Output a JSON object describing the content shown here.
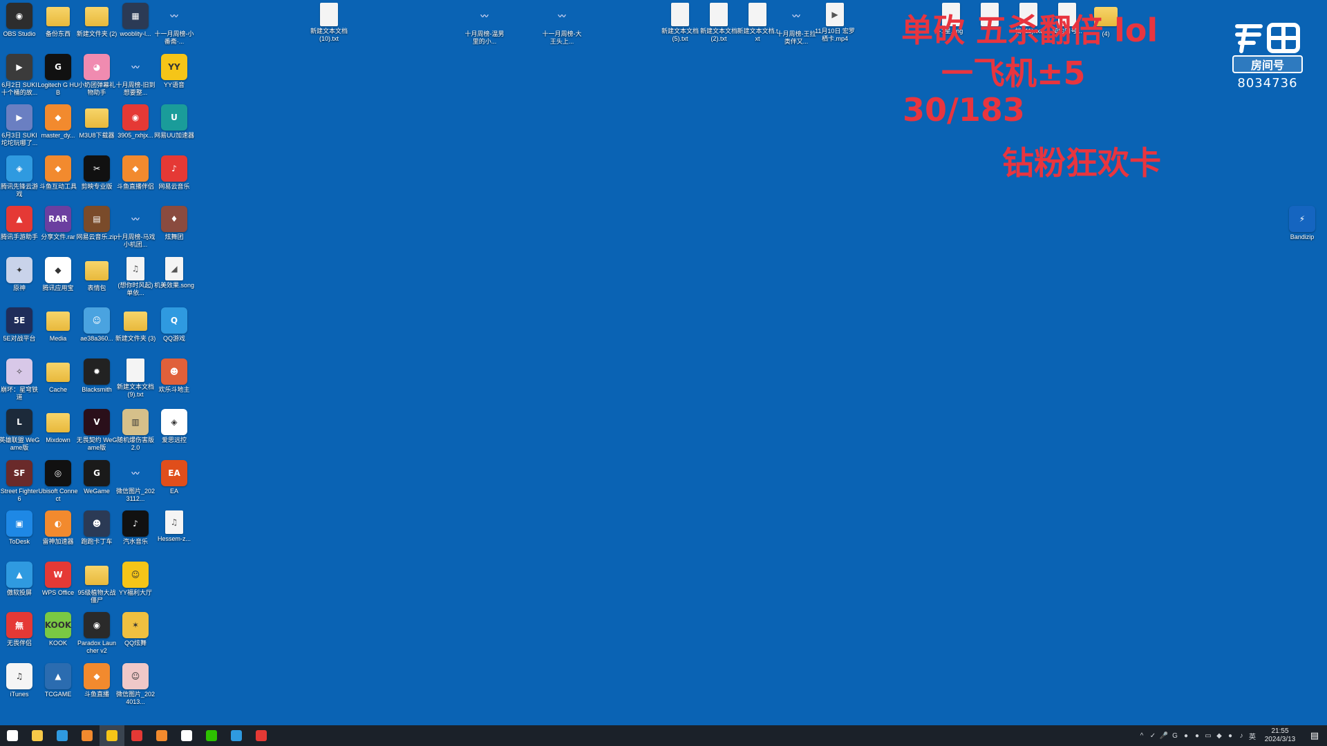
{
  "desktop_icons": [
    {
      "label": "OBS Studio",
      "kind": "app",
      "color": "#2d2d2d",
      "glyph": "◉",
      "icon": "obs-icon"
    },
    {
      "label": "备份东西",
      "kind": "folder",
      "color": "#e8b93c",
      "glyph": "",
      "icon": "folder-icon"
    },
    {
      "label": "新建文件夹 (2)",
      "kind": "folder",
      "color": "#e8b93c",
      "glyph": "",
      "icon": "folder-icon"
    },
    {
      "label": "wooblity-l...",
      "kind": "app",
      "color": "#2b3a55",
      "glyph": "▦",
      "icon": "app-icon"
    },
    {
      "label": "十一月周榜-小番斋·...",
      "kind": "sticker",
      "color": "#0a63b4",
      "glyph": "〰",
      "icon": "image-icon"
    },
    {
      "label": "6月2日 SUKI 十个桶的故...",
      "kind": "app",
      "color": "#3b3b3b",
      "glyph": "▶",
      "icon": "video-icon"
    },
    {
      "label": "Logitech G HUB",
      "kind": "app",
      "color": "#111111",
      "glyph": "G",
      "icon": "logitech-icon"
    },
    {
      "label": "小奶团弹幕礼物助手",
      "kind": "app",
      "color": "#f08bb0",
      "glyph": "◕",
      "icon": "app-icon"
    },
    {
      "label": "十月周榜-旧到想要整...",
      "kind": "sticker",
      "color": "#0a63b4",
      "glyph": "〰",
      "icon": "image-icon"
    },
    {
      "label": "YY语音",
      "kind": "app",
      "color": "#f5c518",
      "glyph": "YY",
      "icon": "yy-icon"
    },
    {
      "label": "6月3日 SUKI 坨坨玩哪了...",
      "kind": "app",
      "color": "#6a7fc2",
      "glyph": "▶",
      "icon": "video-icon"
    },
    {
      "label": "master_dy...",
      "kind": "app",
      "color": "#f28a2e",
      "glyph": "◆",
      "icon": "douyu-icon"
    },
    {
      "label": "M3U8下载器",
      "kind": "folder",
      "color": "#e8b93c",
      "glyph": "",
      "icon": "folder-icon"
    },
    {
      "label": "3905_rxhjx...",
      "kind": "app",
      "color": "#e53935",
      "glyph": "◉",
      "icon": "app-icon"
    },
    {
      "label": "网易UU加速器",
      "kind": "app",
      "color": "#1a9c9a",
      "glyph": "U",
      "icon": "uu-icon"
    },
    {
      "label": "腾讯先锋云游戏",
      "kind": "app",
      "color": "#2f9ae0",
      "glyph": "◈",
      "icon": "app-icon"
    },
    {
      "label": "斗鱼互动工具",
      "kind": "app",
      "color": "#f28a2e",
      "glyph": "◆",
      "icon": "douyu-icon"
    },
    {
      "label": "剪映专业版",
      "kind": "app",
      "color": "#111111",
      "glyph": "✂",
      "icon": "capcut-icon"
    },
    {
      "label": "斗鱼直播伴侣",
      "kind": "app",
      "color": "#f28a2e",
      "glyph": "◆",
      "icon": "douyu-icon"
    },
    {
      "label": "网易云音乐",
      "kind": "app",
      "color": "#e53935",
      "glyph": "♪",
      "icon": "netease-music-icon"
    },
    {
      "label": "腾讯手游助手",
      "kind": "app",
      "color": "#e53935",
      "glyph": "▲",
      "icon": "app-icon"
    },
    {
      "label": "分享文件.rar",
      "kind": "app",
      "color": "#6b3fa0",
      "glyph": "RAR",
      "icon": "rar-icon"
    },
    {
      "label": "网易云音乐.zip",
      "kind": "app",
      "color": "#7a4b2a",
      "glyph": "▤",
      "icon": "zip-icon"
    },
    {
      "label": "十月周榜-马戏小机团...",
      "kind": "sticker",
      "color": "#0a63b4",
      "glyph": "〰",
      "icon": "image-icon"
    },
    {
      "label": "炫舞团",
      "kind": "app",
      "color": "#8a4b3f",
      "glyph": "♦",
      "icon": "app-icon"
    },
    {
      "label": "原神",
      "kind": "app",
      "color": "#c9d3ea",
      "glyph": "✦",
      "icon": "genshin-icon"
    },
    {
      "label": "腾讯应用宝",
      "kind": "app",
      "color": "#ffffff",
      "glyph": "◆",
      "icon": "app-icon"
    },
    {
      "label": "表情包",
      "kind": "folder",
      "color": "#e8b93c",
      "glyph": "",
      "icon": "folder-icon"
    },
    {
      "label": "(想你时风起) 单依...",
      "kind": "doc",
      "color": "#f4f4f4",
      "glyph": "♫",
      "icon": "mp3-icon"
    },
    {
      "label": "机美效果.song",
      "kind": "doc",
      "color": "#f4f4f4",
      "glyph": "◢",
      "icon": "file-icon"
    },
    {
      "label": "5E对战平台",
      "kind": "app",
      "color": "#1f2d5a",
      "glyph": "5E",
      "icon": "app-icon"
    },
    {
      "label": "Media",
      "kind": "folder",
      "color": "#e8b93c",
      "glyph": "",
      "icon": "folder-icon"
    },
    {
      "label": "ae38a360...",
      "kind": "app",
      "color": "#4aa3e0",
      "glyph": "☺",
      "icon": "image-icon"
    },
    {
      "label": "新建文件夹 (3)",
      "kind": "folder",
      "color": "#e8b93c",
      "glyph": "",
      "icon": "folder-icon"
    },
    {
      "label": "QQ游戏",
      "kind": "app",
      "color": "#2f9ae0",
      "glyph": "Q",
      "icon": "qq-game-icon"
    },
    {
      "label": "崩坏：星穹铁道",
      "kind": "app",
      "color": "#d8c8e8",
      "glyph": "✧",
      "icon": "app-icon"
    },
    {
      "label": "Cache",
      "kind": "folder",
      "color": "#e8b93c",
      "glyph": "",
      "icon": "folder-icon"
    },
    {
      "label": "Blacksmith",
      "kind": "app",
      "color": "#222222",
      "glyph": "✹",
      "icon": "app-icon"
    },
    {
      "label": "新建文本文档 (9).txt",
      "kind": "doc",
      "color": "#f4f4f4",
      "glyph": "",
      "icon": "text-file-icon"
    },
    {
      "label": "欢乐斗地主",
      "kind": "app",
      "color": "#e0603a",
      "glyph": "☻",
      "icon": "app-icon"
    },
    {
      "label": "英雄联盟 WeGame版",
      "kind": "app",
      "color": "#1c2a3a",
      "glyph": "L",
      "icon": "lol-icon"
    },
    {
      "label": "Mixdown",
      "kind": "folder",
      "color": "#e8b93c",
      "glyph": "",
      "icon": "folder-icon"
    },
    {
      "label": "无畏契约 WeGame版",
      "kind": "app",
      "color": "#2a0f1a",
      "glyph": "V",
      "icon": "valorant-icon"
    },
    {
      "label": "随机爆伤害版2.0",
      "kind": "app",
      "color": "#d6c08a",
      "glyph": "▥",
      "icon": "zip-icon"
    },
    {
      "label": "爱思远控",
      "kind": "app",
      "color": "#ffffff",
      "glyph": "◈",
      "icon": "app-icon"
    },
    {
      "label": "Street Fighter 6",
      "kind": "app",
      "color": "#6a2a2a",
      "glyph": "SF",
      "icon": "app-icon"
    },
    {
      "label": "Ubisoft Connect",
      "kind": "app",
      "color": "#111111",
      "glyph": "◎",
      "icon": "ubisoft-icon"
    },
    {
      "label": "WeGame",
      "kind": "app",
      "color": "#1a1a1a",
      "glyph": "G",
      "icon": "wegame-icon"
    },
    {
      "label": "微信图片_2023112...",
      "kind": "sticker",
      "color": "#0a63b4",
      "glyph": "〰",
      "icon": "image-icon"
    },
    {
      "label": "EA",
      "kind": "app",
      "color": "#e04e1b",
      "glyph": "EA",
      "icon": "ea-icon"
    },
    {
      "label": "ToDesk",
      "kind": "app",
      "color": "#1e88e5",
      "glyph": "▣",
      "icon": "todesk-icon"
    },
    {
      "label": "雷神加速器",
      "kind": "app",
      "color": "#f28a2e",
      "glyph": "◐",
      "icon": "app-icon"
    },
    {
      "label": "跑跑卡丁车",
      "kind": "app",
      "color": "#2b3a55",
      "glyph": "☻",
      "icon": "app-icon"
    },
    {
      "label": "汽水音乐",
      "kind": "app",
      "color": "#111111",
      "glyph": "♪",
      "icon": "app-icon"
    },
    {
      "label": "Hessem-z...",
      "kind": "doc",
      "color": "#f4f4f4",
      "glyph": "♫",
      "icon": "wav-icon"
    },
    {
      "label": "傲软投屏",
      "kind": "app",
      "color": "#2f9ae0",
      "glyph": "▲",
      "icon": "app-icon"
    },
    {
      "label": "WPS Office",
      "kind": "app",
      "color": "#e53935",
      "glyph": "W",
      "icon": "wps-icon"
    },
    {
      "label": "95级植物大战僵尸",
      "kind": "folder",
      "color": "#e8b93c",
      "glyph": "",
      "icon": "folder-icon"
    },
    {
      "label": "YY福利大厅",
      "kind": "app",
      "color": "#f5c518",
      "glyph": "☺",
      "icon": "app-icon"
    },
    {
      "label": "无畏伴侣",
      "kind": "app",
      "color": "#e53935",
      "glyph": "無",
      "icon": "app-icon"
    },
    {
      "label": "KOOK",
      "kind": "app",
      "color": "#7ac943",
      "glyph": "KOOK",
      "icon": "kook-icon"
    },
    {
      "label": "Paradox Launcher v2",
      "kind": "app",
      "color": "#2a2a2a",
      "glyph": "◉",
      "icon": "app-icon"
    },
    {
      "label": "QQ炫舞",
      "kind": "app",
      "color": "#f0c040",
      "glyph": "✶",
      "icon": "app-icon"
    },
    {
      "label": "iTunes",
      "kind": "app",
      "color": "#f5f5f5",
      "glyph": "♫",
      "icon": "itunes-icon"
    },
    {
      "label": "TCGAME",
      "kind": "app",
      "color": "#2b6cb0",
      "glyph": "▲",
      "icon": "app-icon"
    },
    {
      "label": "斗鱼直播",
      "kind": "app",
      "color": "#f28a2e",
      "glyph": "◆",
      "icon": "douyu-icon"
    },
    {
      "label": "微信图片_2024013...",
      "kind": "app",
      "color": "#f0c8c8",
      "glyph": "☺",
      "icon": "image-icon"
    }
  ],
  "top_files": [
    {
      "label": "新建文本文档 (10).txt",
      "kind": "doc",
      "glyph": "",
      "icon": "text-file-icon"
    },
    {
      "label": "十月周榜-温男里的小...",
      "kind": "sticker",
      "glyph": "〰",
      "icon": "image-icon"
    },
    {
      "label": "十一月周榜-大王头上...",
      "kind": "sticker",
      "glyph": "〰",
      "icon": "image-icon"
    },
    {
      "label": "新建文本文档 (5).txt",
      "kind": "doc",
      "glyph": "",
      "icon": "text-file-icon"
    },
    {
      "label": "新建文本文档 (2).txt",
      "kind": "doc",
      "glyph": "",
      "icon": "text-file-icon"
    },
    {
      "label": "新建文本文档.txt",
      "kind": "doc",
      "glyph": "",
      "icon": "text-file-icon"
    },
    {
      "label": "十月周榜-王拉类伴又...",
      "kind": "sticker",
      "glyph": "〰",
      "icon": "image-icon"
    },
    {
      "label": "11月10日 宏罗栖卡.mp4",
      "kind": "doc",
      "glyph": "▶",
      "icon": "video-file-icon"
    },
    {
      "label": "-1星.png",
      "kind": "doc",
      "glyph": "",
      "icon": "image-file-icon"
    },
    {
      "label": "",
      "kind": "doc",
      "glyph": "",
      "icon": "text-file-icon"
    },
    {
      "label": "档 (11).txt",
      "kind": "doc",
      "glyph": "",
      "icon": "text-file-icon"
    },
    {
      "label": "契约口号...",
      "kind": "doc",
      "glyph": "",
      "icon": "text-file-icon"
    },
    {
      "label": "(4)",
      "kind": "folder",
      "glyph": "",
      "icon": "folder-icon"
    }
  ],
  "right_icon": {
    "label": "Bandizip",
    "glyph": "⚡",
    "icon": "bandizip-icon"
  },
  "overlay": {
    "line1": "单砍 五杀翻倍 lol",
    "line2": "一飞机±5",
    "line3": "30/183",
    "line4": "钻粉狂欢卡"
  },
  "logo": {
    "room_label": "房间号",
    "room_number": "8034736",
    "brand": "斗鱼"
  },
  "taskbar": {
    "buttons": [
      {
        "icon": "start-icon",
        "color": "#ffffff"
      },
      {
        "icon": "file-explorer-icon",
        "color": "#f7c948"
      },
      {
        "icon": "kugou-icon",
        "color": "#2f9ae0"
      },
      {
        "icon": "douyu-live-icon",
        "color": "#f28a2e"
      },
      {
        "icon": "yy-icon",
        "color": "#f5c518"
      },
      {
        "icon": "netease-music-icon",
        "color": "#e53935"
      },
      {
        "icon": "douyu-tool-icon",
        "color": "#f28a2e"
      },
      {
        "icon": "capcut-icon",
        "color": "#ffffff"
      },
      {
        "icon": "wechat-icon",
        "color": "#2dc100"
      },
      {
        "icon": "qq-browser-icon",
        "color": "#2f9ae0"
      },
      {
        "icon": "app-red-icon",
        "color": "#e53935"
      }
    ],
    "tray_glyphs": [
      "^",
      "✓",
      "🎤",
      "G",
      "●",
      "●",
      "▭",
      "◆",
      "●",
      "♪",
      "英"
    ],
    "time": "21:55",
    "date": "2024/3/13",
    "notify_glyph": "▤"
  }
}
